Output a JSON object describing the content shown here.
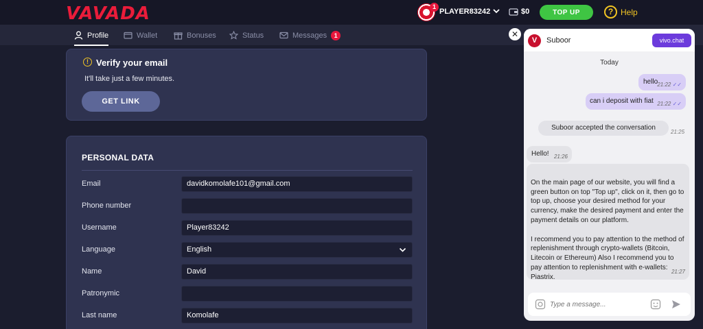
{
  "header": {
    "logo": "VAVADA",
    "avatar_badge": "1",
    "username": "PLAYER83242",
    "balance": "$0",
    "topup_label": "TOP UP",
    "help_label": "Help"
  },
  "nav": {
    "tabs": [
      {
        "label": "Profile",
        "icon": "user-icon",
        "active": true
      },
      {
        "label": "Wallet",
        "icon": "wallet-icon"
      },
      {
        "label": "Bonuses",
        "icon": "gift-icon"
      },
      {
        "label": "Status",
        "icon": "star-icon"
      },
      {
        "label": "Messages",
        "icon": "envelope-icon",
        "badge": "1"
      }
    ]
  },
  "verify": {
    "title": "Verify your email",
    "subtitle": "It'll take just a few minutes.",
    "button": "GET LINK"
  },
  "personal": {
    "title": "PERSONAL DATA",
    "fields": [
      {
        "label": "Email",
        "value": "davidkomolafe101@gmail.com"
      },
      {
        "label": "Phone number",
        "value": ""
      },
      {
        "label": "Username",
        "value": "Player83242"
      },
      {
        "label": "Language",
        "value": "English"
      },
      {
        "label": "Name",
        "value": "David"
      },
      {
        "label": "Patronymic",
        "value": ""
      },
      {
        "label": "Last name",
        "value": "Komolafe"
      }
    ]
  },
  "chat": {
    "agent": "Suboor",
    "brand": "vivo.chat",
    "day": "Today",
    "messages": [
      {
        "text": "hello",
        "time": "21:22"
      },
      {
        "text": "can i deposit with fiat",
        "time": "21:22"
      }
    ],
    "system": {
      "text": "Suboor accepted the conversation",
      "time": "21:25"
    },
    "agent_messages": [
      {
        "text": "Hello!",
        "time": "21:26"
      },
      {
        "text": "On the main page of our website, you will find a green button on top \"Top up\", click on it, then go to top up, choose your desired method for your currency,  make the desired payment and enter the payment details on our platform.\n\nI recommend you to pay attention to the method of replenishment through crypto-wallets (Bitcoin, Litecoin or Ethereum) Also I recommend you to pay attention to replenishment with e-wallets: Piastrix.",
        "time": "21:27"
      }
    ],
    "input_placeholder": "Type a message..."
  },
  "colors": {
    "brand_red": "#ea1c3a",
    "topup_green": "#3fc543",
    "help_yellow": "#f2c523",
    "vivo_purple": "#6c3bdc"
  }
}
